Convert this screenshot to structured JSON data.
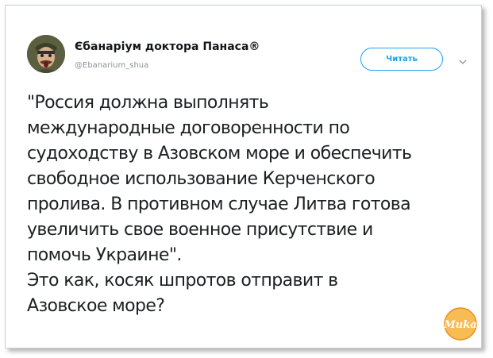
{
  "tweet": {
    "author": {
      "display_name": "Єбанаріум доктора Панаса®",
      "handle": "@Ebanarium_shua",
      "avatar_icon": "user-avatar-icon"
    },
    "follow_label": "Читать",
    "menu_icon": "chevron-down-icon",
    "text": "\"Россия должна выполнять\nмеждународные договоренности по\nсудоходству в Азовском море и обеспечить\nсвободное использование Керченского\nпролива. В противном случае Литва готова\nувеличить свое военное присутствие и\nпомочь Украине\".\nЭто как, косяк шпротов отправит в\nАзовское море?"
  },
  "watermark": {
    "label": "Muka",
    "color": "#f5a623"
  },
  "colors": {
    "accent": "#1da1f2",
    "text": "#1c2022",
    "secondary": "#8a9299"
  }
}
